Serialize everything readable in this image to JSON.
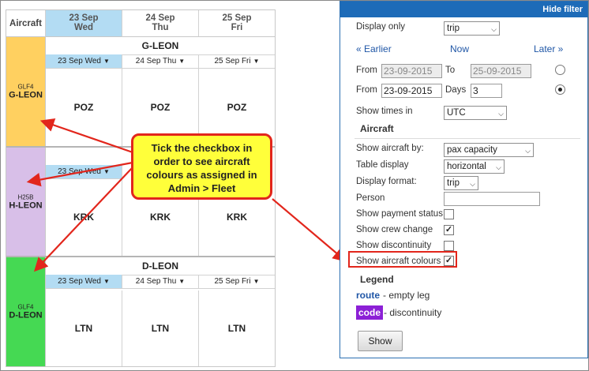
{
  "grid": {
    "aircraft_header": "Aircraft",
    "days": [
      {
        "date": "23 Sep",
        "weekday": "Wed"
      },
      {
        "date": "24 Sep",
        "weekday": "Thu"
      },
      {
        "date": "25 Sep",
        "weekday": "Fri"
      }
    ],
    "day_selectors": [
      "23 Sep Wed",
      "24 Sep Thu",
      "25 Sep Fri"
    ],
    "aircraft": [
      {
        "type": "GLF4",
        "reg": "G-LEON",
        "name": "G-LEON",
        "color": "#ffd060",
        "flights": [
          "POZ",
          "POZ",
          "POZ"
        ]
      },
      {
        "type": "H25B",
        "reg": "H-LEON",
        "name": "H-LEON",
        "color": "#d8bfe8",
        "flights": [
          "KRK",
          "KRK",
          "KRK"
        ]
      },
      {
        "type": "GLF4",
        "reg": "D-LEON",
        "name": "D-LEON",
        "color": "#45d953",
        "flights": [
          "LTN",
          "LTN",
          "LTN"
        ]
      }
    ],
    "h_leon_day1_partial": "23 Sep Wed"
  },
  "callout": {
    "line1": "Tick the checkbox in",
    "line2": "order to see aircraft",
    "line3": "colours as assigned in",
    "line4": "Admin > Fleet"
  },
  "filter": {
    "hide_label": "Hide filter",
    "display_only_label": "Display only",
    "display_only_value": "trip",
    "nav_earlier": "« Earlier",
    "nav_now": "Now",
    "nav_later": "Later »",
    "from_label": "From",
    "to_label": "To",
    "range_from": "23-09-2015",
    "range_to": "25-09-2015",
    "from2_label": "From",
    "days_label": "Days",
    "from2_value": "23-09-2015",
    "days_value": "3",
    "show_times_label": "Show times in",
    "show_times_value": "UTC",
    "aircraft_section": "Aircraft",
    "show_aircraft_by_label": "Show aircraft by:",
    "show_aircraft_by_value": "pax capacity",
    "table_display_label": "Table display",
    "table_display_value": "horizontal",
    "display_format_label": "Display format:",
    "display_format_value": "trip",
    "person_label": "Person",
    "person_value": "",
    "payment_label": "Show payment status",
    "crew_label": "Show crew change",
    "discontinuity_label": "Show discontinuity",
    "colours_label": "Show aircraft colours",
    "checks": {
      "payment": false,
      "crew": true,
      "discontinuity": false,
      "colours": true
    },
    "legend_title": "Legend",
    "legend_route": "route",
    "legend_route_desc": "- empty leg",
    "legend_code": "code",
    "legend_code_desc": "- discontinuity",
    "show_button": "Show"
  }
}
